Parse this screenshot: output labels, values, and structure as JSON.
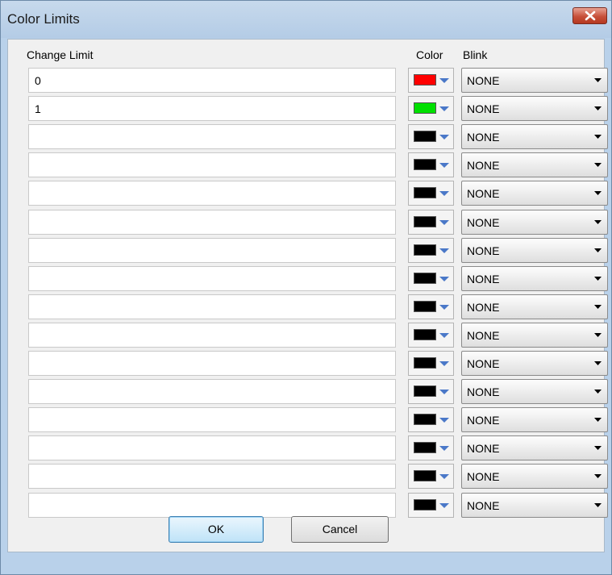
{
  "window": {
    "title": "Color Limits",
    "close_icon": "close-icon"
  },
  "headers": {
    "change_limit": "Change Limit",
    "color": "Color",
    "blink": "Blink"
  },
  "rows": [
    {
      "limit": "0",
      "color": "#ff0000",
      "blink": "NONE"
    },
    {
      "limit": "1",
      "color": "#00e000",
      "blink": "NONE"
    },
    {
      "limit": "",
      "color": "#000000",
      "blink": "NONE"
    },
    {
      "limit": "",
      "color": "#000000",
      "blink": "NONE"
    },
    {
      "limit": "",
      "color": "#000000",
      "blink": "NONE"
    },
    {
      "limit": "",
      "color": "#000000",
      "blink": "NONE"
    },
    {
      "limit": "",
      "color": "#000000",
      "blink": "NONE"
    },
    {
      "limit": "",
      "color": "#000000",
      "blink": "NONE"
    },
    {
      "limit": "",
      "color": "#000000",
      "blink": "NONE"
    },
    {
      "limit": "",
      "color": "#000000",
      "blink": "NONE"
    },
    {
      "limit": "",
      "color": "#000000",
      "blink": "NONE"
    },
    {
      "limit": "",
      "color": "#000000",
      "blink": "NONE"
    },
    {
      "limit": "",
      "color": "#000000",
      "blink": "NONE"
    },
    {
      "limit": "",
      "color": "#000000",
      "blink": "NONE"
    },
    {
      "limit": "",
      "color": "#000000",
      "blink": "NONE"
    },
    {
      "limit": "",
      "color": "#000000",
      "blink": "NONE"
    }
  ],
  "buttons": {
    "ok": "OK",
    "cancel": "Cancel"
  },
  "colors": {
    "arrow_blue": "#4a78c8",
    "accent_border": "#3c7fb1"
  }
}
